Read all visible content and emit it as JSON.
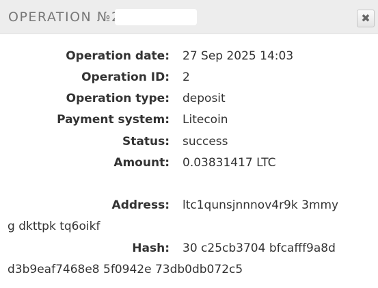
{
  "dialog": {
    "title": "OPERATION №224",
    "close_glyph": "✖",
    "close_icon": "close-icon"
  },
  "details": {
    "date_label": "Operation date:",
    "date_value": "27 Sep 2025 14:03",
    "id_label": "Operation ID:",
    "id_value": "2",
    "type_label": "Operation type:",
    "type_value": "deposit",
    "system_label": "Payment system:",
    "system_value": "Litecoin",
    "status_label": "Status:",
    "status_value": "success",
    "amount_label": "Amount:",
    "amount_value": "0.03831417 LTC",
    "address_label": "Address:",
    "address_value": "ltc1qunsjnnnov4r9k   3mmy",
    "address_value_cont": "g  dkttpk tq6oikf",
    "hash_label": "Hash:",
    "hash_value": "30   c25cb3704 bfcafff9a8d",
    "hash_value_cont": "d3b9eaf7468e8   5f0942e    73db0db072c5"
  }
}
